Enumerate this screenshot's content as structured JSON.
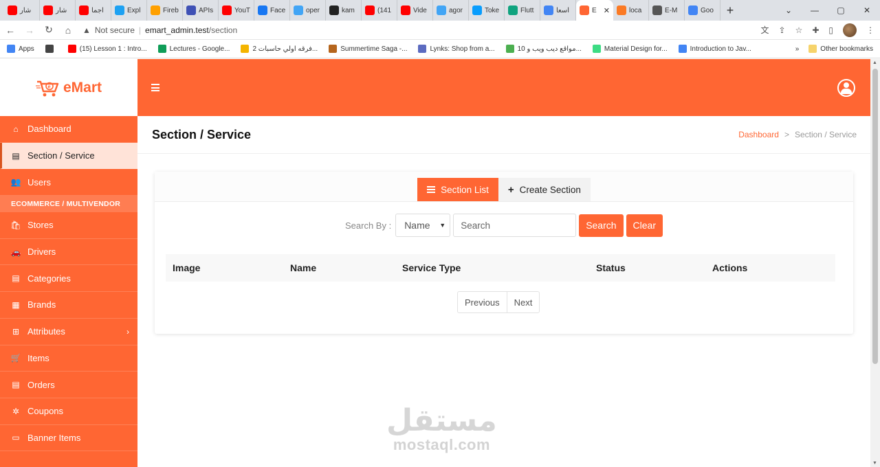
{
  "browser": {
    "tabs": [
      {
        "label": "شار",
        "favicon": "youtube-icon",
        "color": "#ff0000"
      },
      {
        "label": "شار",
        "favicon": "youtube-icon",
        "color": "#ff0000"
      },
      {
        "label": "اجما",
        "favicon": "youtube-icon",
        "color": "#ff0000"
      },
      {
        "label": "Expl",
        "favicon": "twitter-icon",
        "color": "#1da1f2"
      },
      {
        "label": "Fireb",
        "favicon": "firebase-icon",
        "color": "#ffa000"
      },
      {
        "label": "APIs",
        "favicon": "api-icon",
        "color": "#3f51b5"
      },
      {
        "label": "YouT",
        "favicon": "youtube-icon",
        "color": "#ff0000"
      },
      {
        "label": "Face",
        "favicon": "facebook-icon",
        "color": "#1877f2"
      },
      {
        "label": "oper",
        "favicon": "flutter-icon",
        "color": "#42a5f5"
      },
      {
        "label": "kam",
        "favicon": "github-icon",
        "color": "#222222"
      },
      {
        "label": "(141",
        "favicon": "youtube-icon",
        "color": "#ff0000"
      },
      {
        "label": "Vide",
        "favicon": "youtube-icon",
        "color": "#ff0000"
      },
      {
        "label": "agor",
        "favicon": "flutter-icon",
        "color": "#42a5f5"
      },
      {
        "label": "Toke",
        "favicon": "agora-icon",
        "color": "#099dfd"
      },
      {
        "label": "Flutt",
        "favicon": "chatgpt-icon",
        "color": "#10a37f"
      },
      {
        "label": "اسعا",
        "favicon": "google-icon",
        "color": "#4285f4"
      },
      {
        "label": "E",
        "favicon": "emart-icon",
        "color": "#ff6633",
        "active": true
      },
      {
        "label": "loca",
        "favicon": "xampp-icon",
        "color": "#fb7a24"
      },
      {
        "label": "E-M",
        "favicon": "globe-icon",
        "color": "#555555"
      },
      {
        "label": "Goo",
        "favicon": "google-icon",
        "color": "#4285f4"
      }
    ],
    "address": {
      "security": "Not secure",
      "host": "emart_admin.test",
      "path": "/section"
    },
    "bookmarks": [
      {
        "label": "Apps",
        "color": "#4285f4"
      },
      {
        "label": "",
        "color": "#444444"
      },
      {
        "label": "(15) Lesson 1 : Intro...",
        "color": "#ff0000"
      },
      {
        "label": "Lectures - Google...",
        "color": "#0f9d58"
      },
      {
        "label": "فرقه اولي حاسبات 2...",
        "color": "#f4b400"
      },
      {
        "label": "Summertime Saga -...",
        "color": "#b5651d"
      },
      {
        "label": "Lynks: Shop from a...",
        "color": "#5c6bc0"
      },
      {
        "label": "10 مواقع ديب ويب و...",
        "color": "#4caf50"
      },
      {
        "label": "Material Design for...",
        "color": "#3ddc84"
      },
      {
        "label": "Introduction to Jav...",
        "color": "#4285f4"
      }
    ],
    "bookmarks_more": "»",
    "other_bookmarks": "Other bookmarks"
  },
  "brand": {
    "name": "eMart",
    "color": "#ff6633"
  },
  "sidebar": {
    "items_top": [
      {
        "label": "Dashboard",
        "icon": "home-icon",
        "glyph": "⌂"
      },
      {
        "label": "Section / Service",
        "icon": "clipboard-icon",
        "glyph": "▤",
        "active": true
      },
      {
        "label": "Users",
        "icon": "users-icon",
        "glyph": "👥"
      }
    ],
    "section_heading": "ECOMMERCE / MULTIVENDOR",
    "items_bottom": [
      {
        "label": "Stores",
        "icon": "shopping-bag-icon",
        "glyph": "🛍"
      },
      {
        "label": "Drivers",
        "icon": "car-icon",
        "glyph": "🚗"
      },
      {
        "label": "Categories",
        "icon": "clipboard-list-icon",
        "glyph": "▤"
      },
      {
        "label": "Brands",
        "icon": "building-icon",
        "glyph": "▦"
      },
      {
        "label": "Attributes",
        "icon": "plus-square-icon",
        "glyph": "⊞",
        "has_children": true
      },
      {
        "label": "Items",
        "icon": "cart-icon",
        "glyph": "🛒"
      },
      {
        "label": "Orders",
        "icon": "list-alt-icon",
        "glyph": "▤"
      },
      {
        "label": "Coupons",
        "icon": "coupon-icon",
        "glyph": "✲"
      },
      {
        "label": "Banner Items",
        "icon": "monitor-icon",
        "glyph": "▭"
      }
    ]
  },
  "page": {
    "title": "Section / Service",
    "breadcrumb": {
      "home": "Dashboard",
      "current": "Section / Service",
      "separator": ">"
    }
  },
  "tabs": {
    "list": "Section List",
    "create": "Create Section"
  },
  "search": {
    "label": "Search By :",
    "select_value": "Name",
    "input_placeholder": "Search",
    "search_button": "Search",
    "clear_button": "Clear"
  },
  "table": {
    "columns": [
      "Image",
      "Name",
      "Service Type",
      "Status",
      "Actions"
    ],
    "rows": []
  },
  "pagination": {
    "previous": "Previous",
    "next": "Next"
  },
  "watermark": {
    "arabic": "مستقل",
    "latin": "mostaql.com"
  }
}
